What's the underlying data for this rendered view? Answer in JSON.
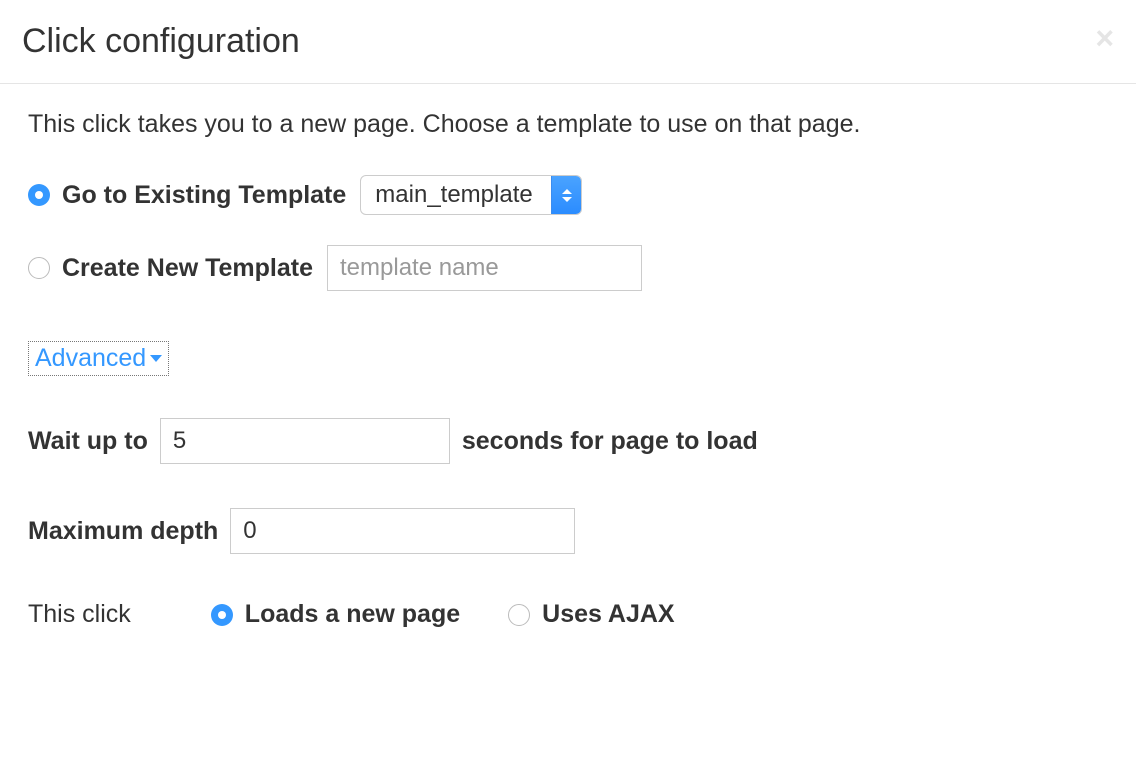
{
  "header": {
    "title": "Click configuration"
  },
  "description": "This click takes you to a new page. Choose a template to use on that page.",
  "option_existing": {
    "label": "Go to Existing Template",
    "selected_value": "main_template"
  },
  "option_create": {
    "label": "Create New Template",
    "placeholder": "template name",
    "value": ""
  },
  "advanced": {
    "label": "Advanced"
  },
  "wait": {
    "label_before": "Wait up to",
    "value": "5",
    "label_after": "seconds for page to load"
  },
  "depth": {
    "label": "Maximum depth",
    "value": "0"
  },
  "click_type": {
    "label": "This click",
    "option_new_page": "Loads a new page",
    "option_ajax": "Uses AJAX"
  }
}
